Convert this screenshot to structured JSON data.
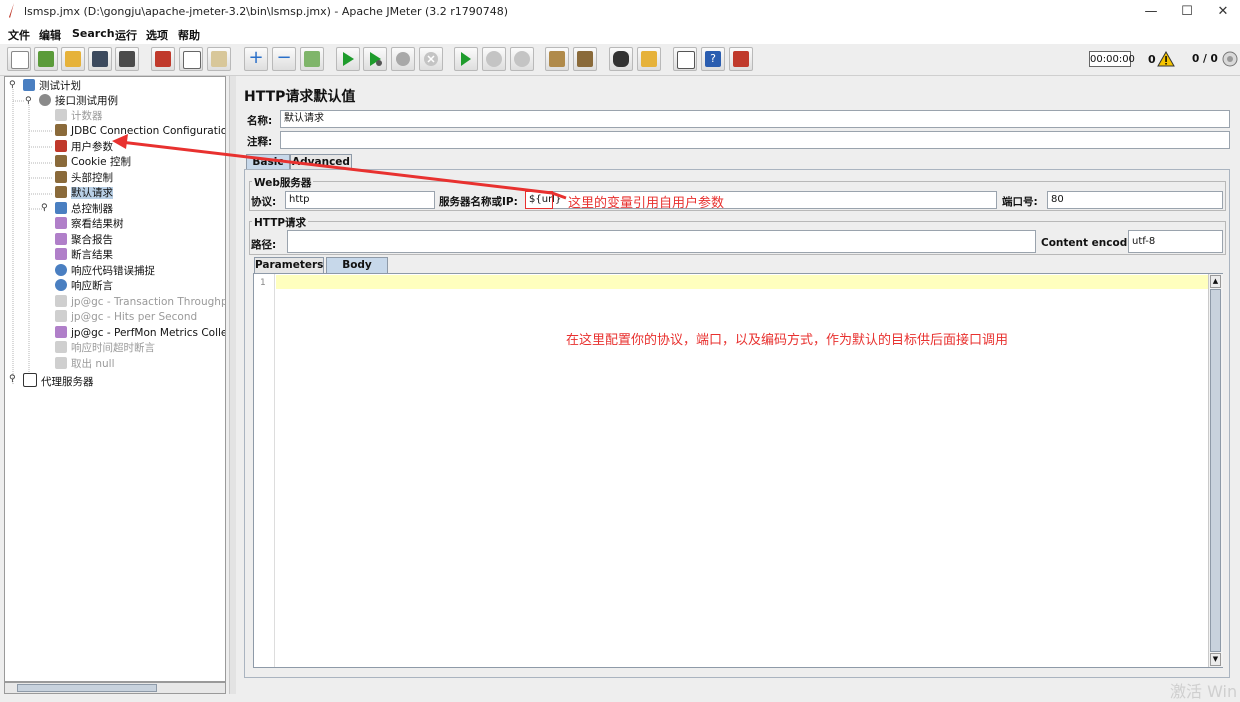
{
  "window": {
    "title": "lsmsp.jmx (D:\\gongju\\apache-jmeter-3.2\\bin\\lsmsp.jmx) - Apache JMeter (3.2 r1790748)",
    "minimize": "—",
    "maximize": "☐",
    "close": "✕"
  },
  "menubar": [
    "文件",
    "编辑",
    "Search",
    "运行",
    "选项",
    "帮助"
  ],
  "toolbar": {
    "timer": "00:00:00",
    "warnings": "0",
    "threads": "0 / 0"
  },
  "tree": {
    "items": [
      {
        "label": "测试计划",
        "icon": "test-plan-icon",
        "disabled": false
      },
      {
        "label": "接口测试用例",
        "icon": "thread-group-icon",
        "disabled": false
      },
      {
        "label": "计数器",
        "icon": "config-element-icon",
        "disabled": true
      },
      {
        "label": "JDBC Connection Configuration",
        "icon": "config-element-icon",
        "disabled": false
      },
      {
        "label": "用户参数",
        "icon": "pre-processor-icon",
        "disabled": false
      },
      {
        "label": "Cookie 控制",
        "icon": "config-element-icon",
        "disabled": false
      },
      {
        "label": "头部控制",
        "icon": "config-element-icon",
        "disabled": false
      },
      {
        "label": "默认请求",
        "icon": "config-element-icon",
        "disabled": false
      },
      {
        "label": "总控制器",
        "icon": "controller-icon",
        "disabled": false
      },
      {
        "label": "察看结果树",
        "icon": "listener-icon",
        "disabled": false
      },
      {
        "label": "聚合报告",
        "icon": "listener-icon",
        "disabled": false
      },
      {
        "label": "断言结果",
        "icon": "listener-icon",
        "disabled": false
      },
      {
        "label": "响应代码错误捕捉",
        "icon": "assertion-icon",
        "disabled": false
      },
      {
        "label": "响应断言",
        "icon": "assertion-icon",
        "disabled": false
      },
      {
        "label": "jp@gc - Transaction Throughput vs",
        "icon": "graph-icon",
        "disabled": true
      },
      {
        "label": "jp@gc - Hits per Second",
        "icon": "graph-icon",
        "disabled": true
      },
      {
        "label": "jp@gc - PerfMon Metrics Collector",
        "icon": "graph-icon",
        "disabled": false
      },
      {
        "label": "响应时间超时断言",
        "icon": "timer-assertion-icon",
        "disabled": true
      },
      {
        "label": "取出 null",
        "icon": "timer-assertion-icon",
        "disabled": true
      },
      {
        "label": "代理服务器",
        "icon": "proxy-icon",
        "disabled": false
      }
    ],
    "selected": "默认请求"
  },
  "panel": {
    "title": "HTTP请求默认值",
    "name_label": "名称:",
    "name_value": "默认请求",
    "comment_label": "注释:",
    "comment_value": "",
    "tabs": [
      "Basic",
      "Advanced"
    ],
    "web_server_group": "Web服务器",
    "protocol_label": "协议:",
    "protocol_value": "http",
    "server_label": "服务器名称或IP:",
    "server_value": "${url}",
    "port_label": "端口号:",
    "port_value": "80",
    "http_request_group": "HTTP请求",
    "path_label": "路径:",
    "path_value": "",
    "encoding_label": "Content encoding:",
    "encoding_value": "utf-8",
    "subtabs": [
      "Parameters",
      "Body Data"
    ],
    "line_number": "1"
  },
  "annotations": {
    "arrow_note": "这里的变量引用自用户参数",
    "config_note": "在这里配置你的协议，端口，以及编码方式，作为默认的目标供后面接口调用",
    "color": "#e8312f"
  },
  "watermark": "激活 Win"
}
